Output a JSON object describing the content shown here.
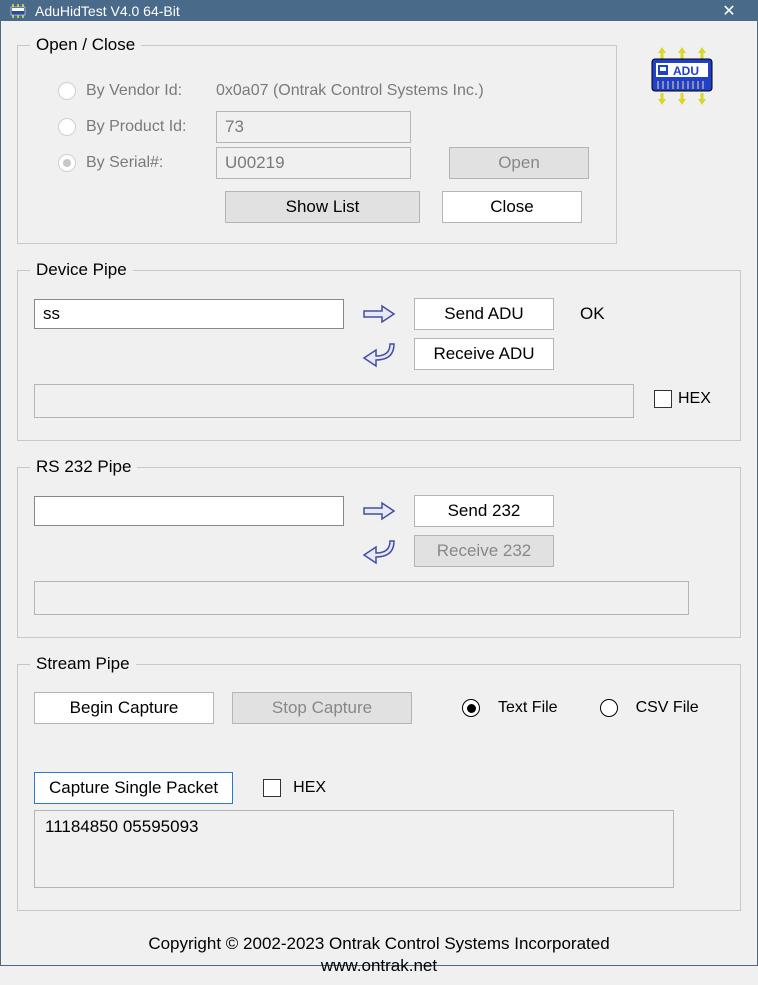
{
  "window": {
    "title": "AduHidTest V4.0 64-Bit"
  },
  "openclose": {
    "legend": "Open / Close",
    "radios": {
      "vendor_label": "By Vendor Id:",
      "product_label": "By Product Id:",
      "serial_label": "By Serial#:"
    },
    "vendor_text": "0x0a07 (Ontrak Control Systems Inc.)",
    "product_value": "73",
    "serial_value": "U00219",
    "open_btn": "Open",
    "showlist_btn": "Show List",
    "close_btn": "Close"
  },
  "device_pipe": {
    "legend": "Device Pipe",
    "input_value": "ss",
    "send_btn": "Send ADU",
    "status": "OK",
    "receive_btn": "Receive ADU",
    "hex_label": "HEX"
  },
  "rs232_pipe": {
    "legend": "RS 232 Pipe",
    "input_value": "",
    "send_btn": "Send 232",
    "receive_btn": "Receive 232"
  },
  "stream_pipe": {
    "legend": "Stream Pipe",
    "begin_btn": "Begin Capture",
    "stop_btn": "Stop Capture",
    "text_file": "Text File",
    "csv_file": "CSV File",
    "capture_single": "Capture Single Packet",
    "hex_label": "HEX",
    "packet_value": "11184850 05595093"
  },
  "footer": {
    "line1": "Copyright © 2002-2023 Ontrak Control Systems Incorporated",
    "line2": "www.ontrak.net"
  }
}
